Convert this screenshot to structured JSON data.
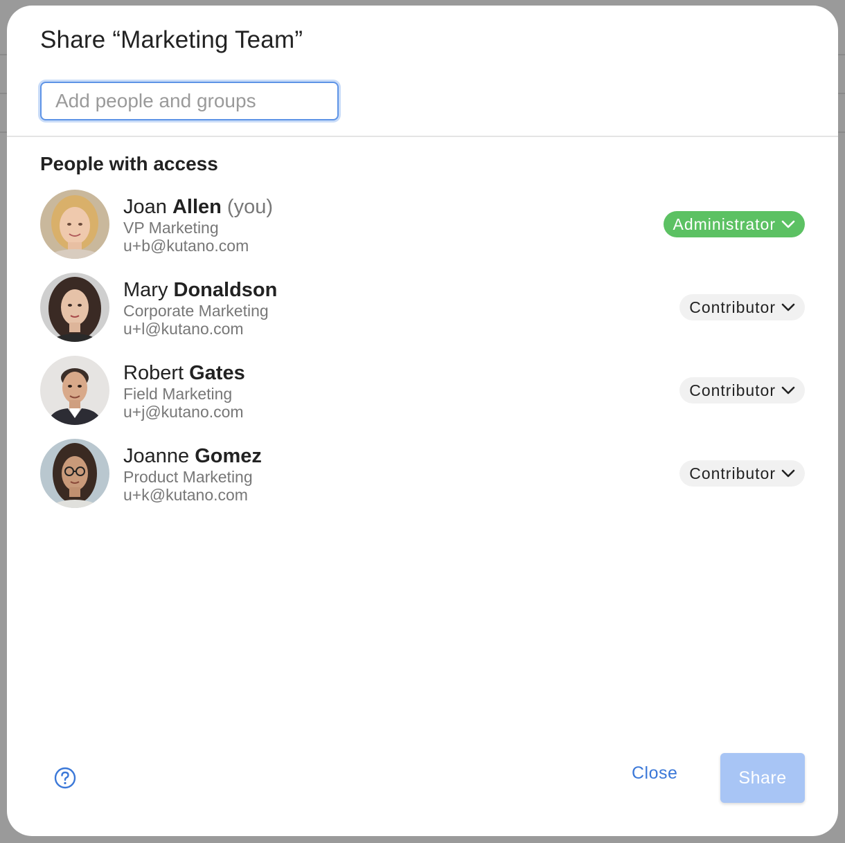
{
  "dialog": {
    "title": "Share “Marketing Team”",
    "search": {
      "placeholder": "Add people and groups",
      "value": ""
    },
    "section_title": "People with access",
    "people": [
      {
        "first_name": "Joan",
        "last_name": "Allen",
        "suffix": "(you)",
        "title": "VP Marketing",
        "email": "u+b@kutano.com",
        "role": "Administrator",
        "role_color": "#5cc163"
      },
      {
        "first_name": "Mary",
        "last_name": "Donaldson",
        "suffix": "",
        "title": "Corporate Marketing",
        "email": "u+l@kutano.com",
        "role": "Contributor",
        "role_color": "#f1f1f1"
      },
      {
        "first_name": "Robert",
        "last_name": "Gates",
        "suffix": "",
        "title": "Field Marketing",
        "email": "u+j@kutano.com",
        "role": "Contributor",
        "role_color": "#f1f1f1"
      },
      {
        "first_name": "Joanne",
        "last_name": "Gomez",
        "suffix": "",
        "title": "Product Marketing",
        "email": "u+k@kutano.com",
        "role": "Contributor",
        "role_color": "#f1f1f1"
      }
    ],
    "footer": {
      "help_icon": "question-circle-icon",
      "close_label": "Close",
      "share_label": "Share"
    }
  },
  "colors": {
    "accent": "#3b78d8",
    "admin_green": "#5cc163",
    "share_disabled": "#a8c5f5"
  }
}
